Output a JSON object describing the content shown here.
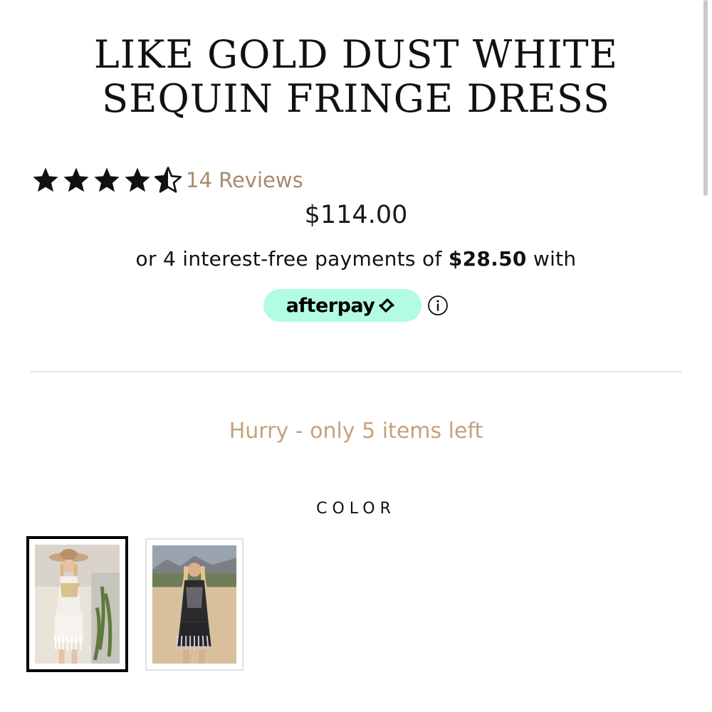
{
  "product": {
    "title_line1": "LIKE GOLD DUST WHITE",
    "title_line2": "SEQUIN FRINGE DRESS",
    "rating": 4.5,
    "rating_max": 5,
    "reviews_label": "14 Reviews",
    "price": "$114.00",
    "installments_prefix": "or 4 interest-free payments of",
    "installment_amount": "$28.50",
    "installments_suffix": "with",
    "afterpay_label": "afterpay",
    "info_icon": "info-icon",
    "stock_message": "Hurry - only 5 items left",
    "color_label": "COLOR",
    "color_options": [
      {
        "name": "white-sequin-fringe",
        "selected": true
      },
      {
        "name": "black-sequin-fringe",
        "selected": false
      }
    ]
  },
  "colors": {
    "accent": "#a58b6c",
    "stock": "#c6a17d",
    "afterpay_mint": "#b2fce4",
    "text": "#111111"
  }
}
